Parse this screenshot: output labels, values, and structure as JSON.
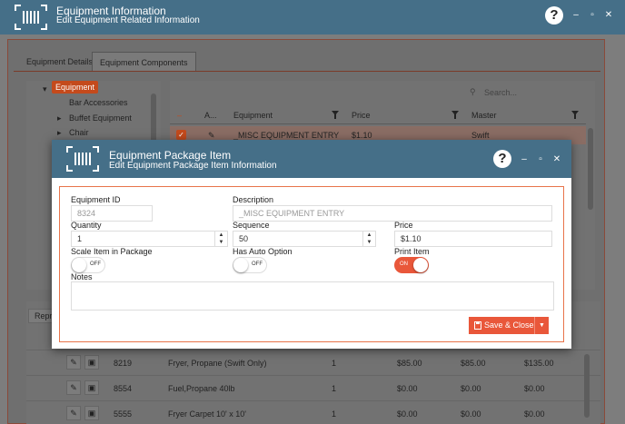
{
  "window": {
    "title": "Equipment Information",
    "subtitle": "Edit Equipment Related Information",
    "help_label": "?",
    "minimize_label": "–",
    "maximize_label": "▫",
    "close_label": "✕"
  },
  "tabs": [
    {
      "label": "Equipment Details"
    },
    {
      "label": "Equipment Components"
    }
  ],
  "tree": {
    "selected": "Equipment",
    "items": [
      {
        "label": "Bar Accessories"
      },
      {
        "label": "Buffet Equipment"
      },
      {
        "label": "Chair"
      }
    ]
  },
  "grid": {
    "search_placeholder": "Search...",
    "columns": {
      "a": "A...",
      "equipment": "Equipment",
      "price": "Price",
      "master": "Master"
    },
    "row": {
      "equipment": "_MISC EQUIPMENT ENTRY",
      "price": "$1.10",
      "master": "Swift"
    }
  },
  "lower": {
    "button_label": "Repri",
    "rows": [
      {
        "id": "8219",
        "name": "Fryer, Propane (Swift Only)",
        "qty": "1",
        "p1": "$85.00",
        "p2": "$85.00",
        "p3": "$135.00"
      },
      {
        "id": "8554",
        "name": "Fuel,Propane 40lb",
        "qty": "1",
        "p1": "$0.00",
        "p2": "$0.00",
        "p3": "$0.00"
      },
      {
        "id": "5555",
        "name": "Fryer Carpet 10' x 10'",
        "qty": "1",
        "p1": "$0.00",
        "p2": "$0.00",
        "p3": "$0.00"
      }
    ]
  },
  "modal": {
    "title": "Equipment Package Item",
    "subtitle": "Edit Equipment Package Item Information",
    "help_label": "?",
    "minimize_label": "–",
    "maximize_label": "▫",
    "close_label": "✕",
    "fields": {
      "equipment_id_label": "Equipment ID",
      "equipment_id_value": "8324",
      "description_label": "Description",
      "description_value": "_MISC EQUIPMENT ENTRY",
      "quantity_label": "Quantity",
      "quantity_value": "1",
      "sequence_label": "Sequence",
      "sequence_value": "50",
      "price_label": "Price",
      "price_value": "$1.10",
      "scale_label": "Scale Item in Package",
      "scale_state": "OFF",
      "auto_label": "Has Auto Option",
      "auto_state": "OFF",
      "print_label": "Print Item",
      "print_state": "ON",
      "notes_label": "Notes",
      "notes_value": ""
    },
    "save_label": "Save & Close",
    "accent": "#e9573a"
  },
  "colors": {
    "header": "#456f88",
    "accent": "#e9573a"
  }
}
